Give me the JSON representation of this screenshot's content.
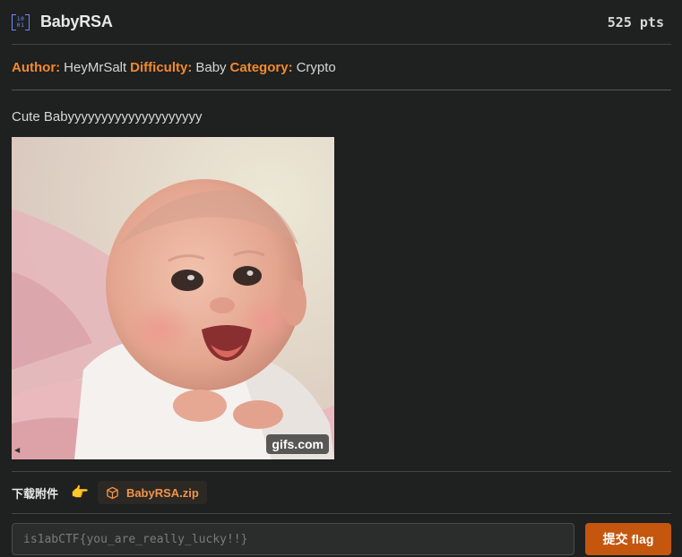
{
  "challenge": {
    "title": "BabyRSA",
    "points": "525 pts",
    "icon": "binary-icon"
  },
  "meta": {
    "author_label": "Author:",
    "author": "HeyMrSalt",
    "difficulty_label": "Difficulty:",
    "difficulty": "Baby",
    "category_label": "Category:",
    "category": "Crypto"
  },
  "description": "Cute Babyyyyyyyyyyyyyyyyyyyy",
  "image": {
    "badge": "gifs.com"
  },
  "attachments": {
    "label": "下载附件",
    "pointer_emoji": "👉",
    "file_name": "BabyRSA.zip"
  },
  "flag": {
    "placeholder": "is1abCTF{you_are_really_lucky!!}",
    "submit_label": "提交 flag"
  },
  "colors": {
    "accent_orange": "#f28a2c",
    "button": "#c4560e",
    "background": "#1f2020",
    "icon_blue": "#6b8cff"
  }
}
